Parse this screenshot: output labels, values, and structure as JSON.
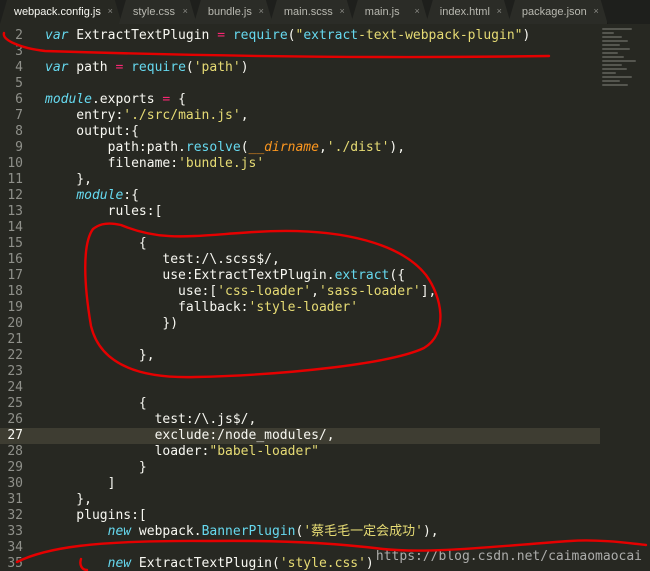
{
  "tabs": [
    {
      "label": "webpack.config.js",
      "active": true
    },
    {
      "label": "style.css",
      "active": false
    },
    {
      "label": "bundle.js",
      "active": false
    },
    {
      "label": "main.scss",
      "active": false
    },
    {
      "label": "main.js",
      "active": false
    },
    {
      "label": "index.html",
      "active": false
    },
    {
      "label": "package.json",
      "active": false
    }
  ],
  "close_glyph": "×",
  "lines": [
    {
      "n": "2",
      "t": "var ExtractTextPlugin = require(\"extract-text-webpack-plugin\")"
    },
    {
      "n": "3",
      "t": ""
    },
    {
      "n": "4",
      "t": "var path = require('path')"
    },
    {
      "n": "5",
      "t": ""
    },
    {
      "n": "6",
      "t": "module.exports = {"
    },
    {
      "n": "7",
      "t": "    entry:'./src/main.js',"
    },
    {
      "n": "8",
      "t": "    output:{"
    },
    {
      "n": "9",
      "t": "        path:path.resolve(__dirname,'./dist'),"
    },
    {
      "n": "10",
      "t": "        filename:'bundle.js'"
    },
    {
      "n": "11",
      "t": "    },"
    },
    {
      "n": "12",
      "t": "    module:{"
    },
    {
      "n": "13",
      "t": "        rules:["
    },
    {
      "n": "14",
      "t": ""
    },
    {
      "n": "15",
      "t": "            {"
    },
    {
      "n": "16",
      "t": "               test:/\\.scss$/,"
    },
    {
      "n": "17",
      "t": "               use:ExtractTextPlugin.extract({"
    },
    {
      "n": "18",
      "t": "                 use:['css-loader','sass-loader'],"
    },
    {
      "n": "19",
      "t": "                 fallback:'style-loader'"
    },
    {
      "n": "20",
      "t": "               })"
    },
    {
      "n": "21",
      "t": ""
    },
    {
      "n": "22",
      "t": "            },"
    },
    {
      "n": "23",
      "t": ""
    },
    {
      "n": "24",
      "t": ""
    },
    {
      "n": "25",
      "t": "            {"
    },
    {
      "n": "26",
      "t": "              test:/\\.js$/,"
    },
    {
      "n": "27",
      "t": "              exclude:/node_modules/,"
    },
    {
      "n": "28",
      "t": "              loader:\"babel-loader\""
    },
    {
      "n": "29",
      "t": "            }"
    },
    {
      "n": "30",
      "t": "        ]"
    },
    {
      "n": "31",
      "t": "    },"
    },
    {
      "n": "32",
      "t": "    plugins:["
    },
    {
      "n": "33",
      "t": "        new webpack.BannerPlugin('蔡毛毛一定会成功'),"
    },
    {
      "n": "34",
      "t": ""
    },
    {
      "n": "35",
      "t": "        new ExtractTextPlugin('style.css')"
    }
  ],
  "watermark": "https://blog.csdn.net/caimaomaocai",
  "colors": {
    "background": "#272822",
    "current_line": "#3e3d32",
    "annotation": "#e50000"
  }
}
